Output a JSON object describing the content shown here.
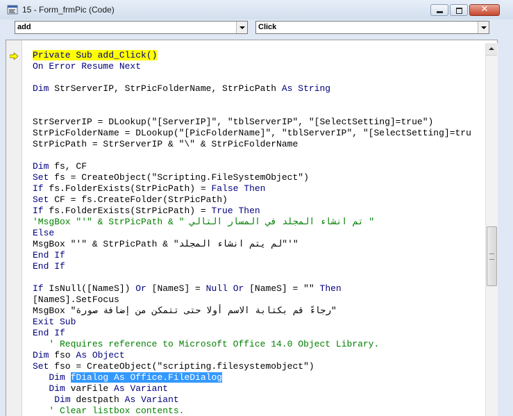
{
  "window": {
    "title": "15 - Form_frmPic (Code)",
    "buttons": [
      "minimize",
      "maximize",
      "close"
    ],
    "close_glyph": "✕"
  },
  "combos": {
    "object_value": "add",
    "procedure_value": "Click"
  },
  "icons": {
    "app": "vba-code-icon",
    "execution_pointer": "execution-arrow-icon"
  },
  "colors": {
    "keyword": "#00007f",
    "comment": "#007f00",
    "current_line_highlight": "#ffff00",
    "selection": "#3399ff"
  },
  "code_lines": [
    [
      {
        "t": "Private Sub add_Click()",
        "c": "kw hl-yellow"
      }
    ],
    [
      {
        "t": "On Error Resume Next",
        "c": "kw"
      }
    ],
    [],
    [
      {
        "t": "Dim",
        "c": "kw"
      },
      {
        "t": " StrServerIP, StrPicFolderName, StrPicPath "
      },
      {
        "t": "As",
        "c": "kw"
      },
      {
        "t": " "
      },
      {
        "t": "String",
        "c": "kw"
      }
    ],
    [],
    [],
    [
      {
        "t": "StrServerIP = DLookup(\"[ServerIP]\", \"tblServerIP\", \"[SelectSetting]=true\")"
      }
    ],
    [
      {
        "t": "StrPicFolderName = DLookup(\"[PicFolderName]\", \"tblServerIP\", \"[SelectSetting]=tru"
      }
    ],
    [
      {
        "t": "StrPicPath = StrServerIP & \"\\\" & StrPicFolderName"
      }
    ],
    [],
    [
      {
        "t": "Dim",
        "c": "kw"
      },
      {
        "t": " fs, CF"
      }
    ],
    [
      {
        "t": "Set",
        "c": "kw"
      },
      {
        "t": " fs = CreateObject(\"Scripting.FileSystemObject\")"
      }
    ],
    [
      {
        "t": "If",
        "c": "kw"
      },
      {
        "t": " fs.FolderExists(StrPicPath) = "
      },
      {
        "t": "False",
        "c": "kw"
      },
      {
        "t": " "
      },
      {
        "t": "Then",
        "c": "kw"
      }
    ],
    [
      {
        "t": "Set",
        "c": "kw"
      },
      {
        "t": " CF = fs.CreateFolder(StrPicPath)"
      }
    ],
    [
      {
        "t": "If",
        "c": "kw"
      },
      {
        "t": " fs.FolderExists(StrPicPath) = "
      },
      {
        "t": "True",
        "c": "kw"
      },
      {
        "t": " "
      },
      {
        "t": "Then",
        "c": "kw"
      }
    ],
    [
      {
        "t": "'MsgBox \"'\" & StrPicPath & \" تم انشاء المجلد في المسار التالي \"",
        "c": "cm"
      }
    ],
    [
      {
        "t": "Else",
        "c": "kw"
      }
    ],
    [
      {
        "t": "MsgBox \"'\" & StrPicPath & \"لم يتم انشاء المجلد\"'\""
      }
    ],
    [
      {
        "t": "End If",
        "c": "kw"
      }
    ],
    [
      {
        "t": "End If",
        "c": "kw"
      }
    ],
    [],
    [
      {
        "t": "If",
        "c": "kw"
      },
      {
        "t": " IsNull([NameS]) "
      },
      {
        "t": "Or",
        "c": "kw"
      },
      {
        "t": " [NameS] = "
      },
      {
        "t": "Null",
        "c": "kw"
      },
      {
        "t": " "
      },
      {
        "t": "Or",
        "c": "kw"
      },
      {
        "t": " [NameS] = \"\" "
      },
      {
        "t": "Then",
        "c": "kw"
      }
    ],
    [
      {
        "t": "[NameS].SetFocus"
      }
    ],
    [
      {
        "t": "MsgBox \"رجاءً قم بكتابة الاسم أولا حتى تتمكن من إضافة صورة\""
      }
    ],
    [
      {
        "t": "Exit Sub",
        "c": "kw"
      }
    ],
    [
      {
        "t": "End If",
        "c": "kw"
      }
    ],
    [
      {
        "t": "   ' Requires reference to Microsoft Office 14.0 Object Library.",
        "c": "cm"
      }
    ],
    [
      {
        "t": "Dim",
        "c": "kw"
      },
      {
        "t": " fso "
      },
      {
        "t": "As",
        "c": "kw"
      },
      {
        "t": " "
      },
      {
        "t": "Object",
        "c": "kw"
      }
    ],
    [
      {
        "t": "Set",
        "c": "kw"
      },
      {
        "t": " fso = CreateObject(\"scripting.filesystemobject\")"
      }
    ],
    [
      {
        "t": "   "
      },
      {
        "t": "Dim",
        "c": "kw"
      },
      {
        "t": " "
      },
      {
        "t": "fDialog As Office.FileDialog",
        "c": "sel"
      }
    ],
    [
      {
        "t": "   "
      },
      {
        "t": "Dim",
        "c": "kw"
      },
      {
        "t": " varFile "
      },
      {
        "t": "As",
        "c": "kw"
      },
      {
        "t": " "
      },
      {
        "t": "Variant",
        "c": "kw"
      }
    ],
    [
      {
        "t": "    "
      },
      {
        "t": "Dim",
        "c": "kw"
      },
      {
        "t": " destpath "
      },
      {
        "t": "As",
        "c": "kw"
      },
      {
        "t": " "
      },
      {
        "t": "Variant",
        "c": "kw"
      }
    ],
    [
      {
        "t": "   ' Clear listbox contents.",
        "c": "cm"
      }
    ]
  ]
}
